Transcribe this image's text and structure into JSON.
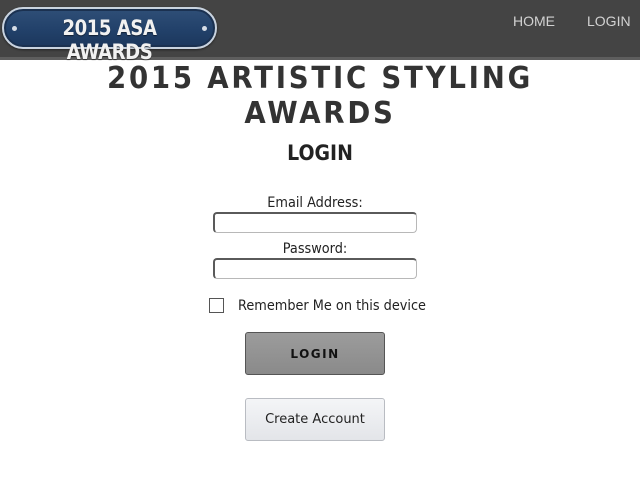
{
  "header": {
    "logo_text": "2015 ASA AWARDS",
    "nav": {
      "home": "HOME",
      "login": "LOGIN"
    }
  },
  "site_title": "2015 ARTISTIC STYLING AWARDS",
  "form": {
    "title": "LOGIN",
    "email_label": "Email Address:",
    "email_value": "",
    "password_label": "Password:",
    "password_value": "",
    "remember_label": "Remember Me on this device",
    "remember_checked": false,
    "login_button": "LOGIN",
    "create_account_button": "Create Account"
  },
  "colors": {
    "topbar": "#444444",
    "logo_blue": "#22416a",
    "login_button": "#8a8a8a",
    "create_button": "#e3e5e9"
  }
}
